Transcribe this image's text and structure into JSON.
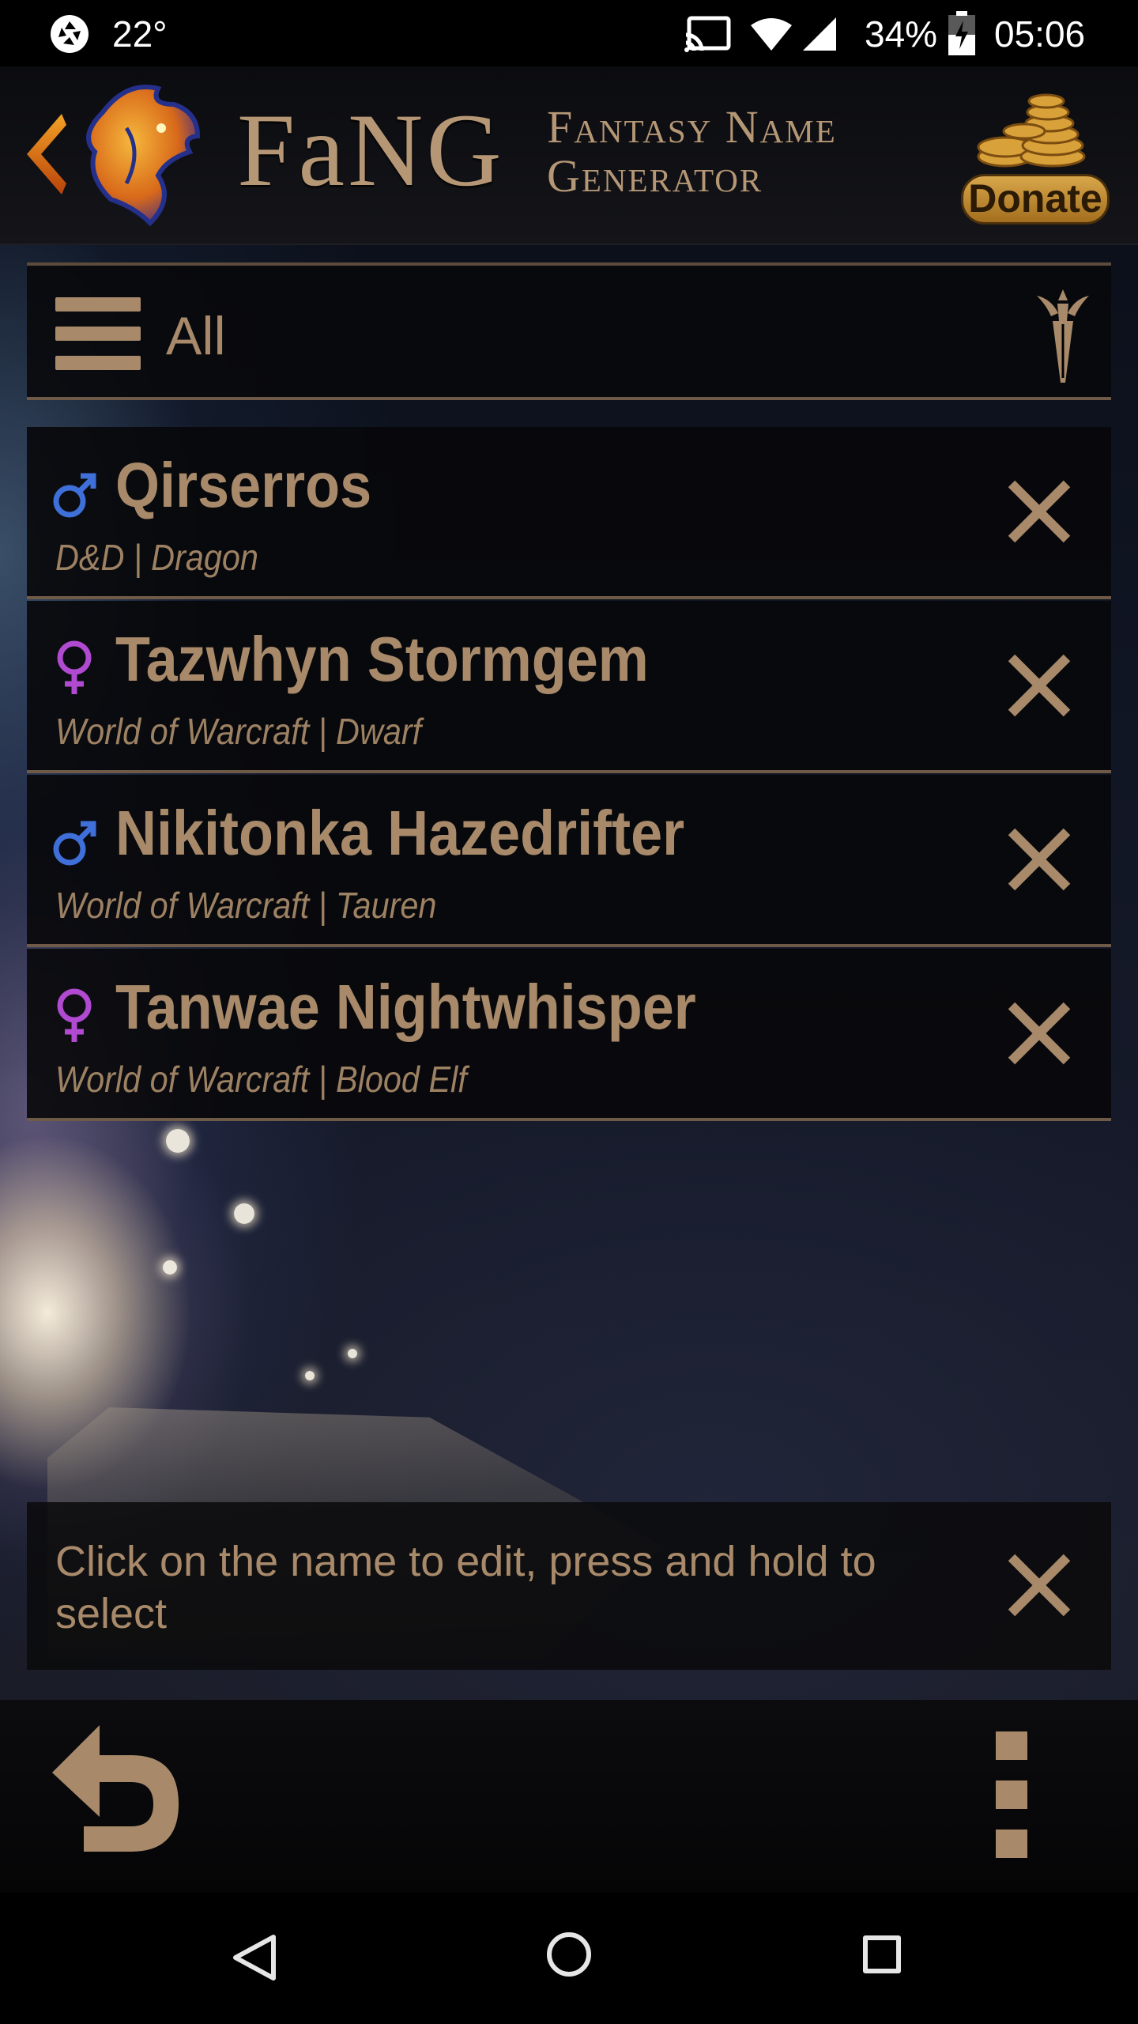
{
  "status_bar": {
    "temperature": "22°",
    "battery_percent": "34%",
    "time": "05:06"
  },
  "header": {
    "brand": "FaNG",
    "subtitle_line1": "Fantasy Name",
    "subtitle_line2": "Generator",
    "donate_label": "Donate"
  },
  "filter": {
    "label": "All"
  },
  "names": [
    {
      "name": "Qirserros",
      "meta": "D&D | Dragon",
      "gender": "male"
    },
    {
      "name": "Tazwhyn Stormgem",
      "meta": "World of Warcraft | Dwarf",
      "gender": "female"
    },
    {
      "name": "Nikitonka Hazedrifter",
      "meta": "World of Warcraft | Tauren",
      "gender": "male"
    },
    {
      "name": "Tanwae Nightwhisper",
      "meta": "World of Warcraft | Blood Elf",
      "gender": "female"
    }
  ],
  "hint": {
    "text": "Click on the name to edit, press and hold to select"
  },
  "colors": {
    "accent": "#a88a6a",
    "male": "#3f6fd8",
    "female": "#b04ad0"
  }
}
